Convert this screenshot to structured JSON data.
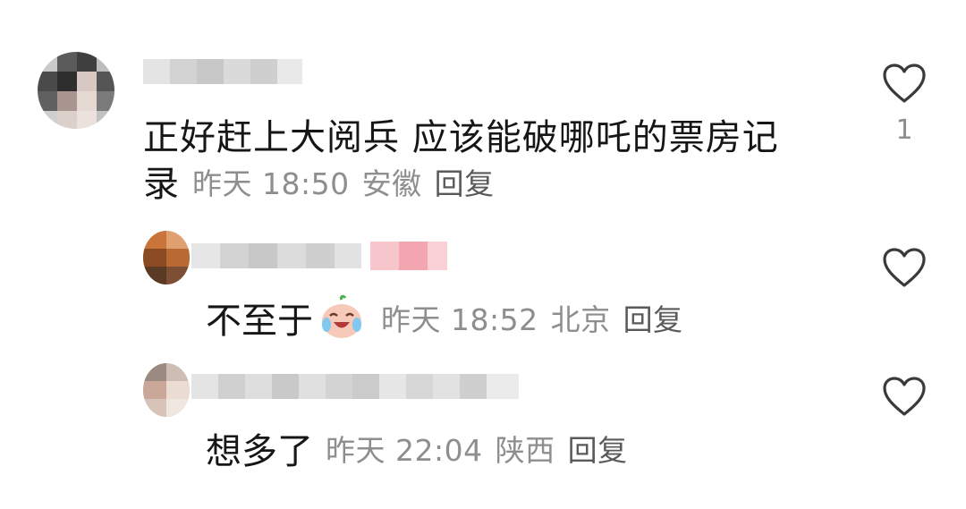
{
  "comments": [
    {
      "text_line1": "正好赶上大阅兵 应该能破哪吒的票房记",
      "text_line2": "录",
      "time": "昨天 18:50",
      "location": "安徽",
      "reply_label": "回复",
      "like_count": "1"
    }
  ],
  "replies": [
    {
      "text": "不至于",
      "emoji": "crying-laughing-emoji",
      "time": "昨天 18:52",
      "location": "北京",
      "reply_label": "回复"
    },
    {
      "text": "想多了",
      "time": "昨天 22:04",
      "location": "陕西",
      "reply_label": "回复"
    }
  ],
  "colors": {
    "text": "#161616",
    "meta": "#8e8e8e",
    "heart_outline": "#3a3a3a",
    "pink_badge": "#f4a6b0"
  },
  "icons": {
    "like": "heart-outline-icon"
  }
}
